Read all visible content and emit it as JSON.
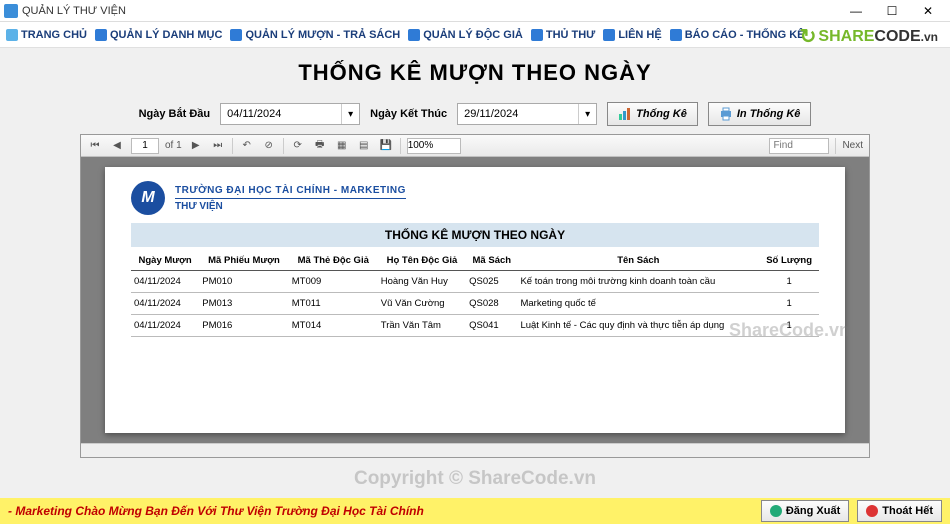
{
  "window": {
    "title": "QUẢN LÝ THƯ VIỆN"
  },
  "menu": {
    "items": [
      {
        "label": "TRANG CHỦ"
      },
      {
        "label": "QUẢN LÝ DANH MỤC"
      },
      {
        "label": "QUẢN LÝ MƯỢN - TRẢ SÁCH"
      },
      {
        "label": "QUẢN LÝ ĐỘC GIẢ"
      },
      {
        "label": "THỦ THƯ"
      },
      {
        "label": "LIÊN HỆ"
      },
      {
        "label": "BÁO CÁO - THỐNG KÊ"
      }
    ]
  },
  "brand": {
    "icon_text": "↻",
    "part1": "SHARE",
    "part2": "CODE",
    "suffix": ".vn"
  },
  "page": {
    "heading": "THỐNG KÊ MƯỢN THEO NGÀY"
  },
  "filter": {
    "start_label": "Ngày Bắt Đầu",
    "start_value": "04/11/2024",
    "end_label": "Ngày Kết Thúc",
    "end_value": "29/11/2024",
    "btn_stats": "Thống Kê",
    "btn_print": "In Thống Kê"
  },
  "viewer": {
    "page_current": "1",
    "page_of": "of 1",
    "zoom": "100%",
    "find_placeholder": "Find",
    "next_label": "Next"
  },
  "report": {
    "org_line1": "TRƯỜNG ĐẠI HỌC TÀI CHÍNH - MARKETING",
    "org_line2": "THƯ VIỆN",
    "logo_letter": "M",
    "title": "THỐNG KÊ MƯỢN THEO NGÀY",
    "columns": [
      "Ngày Mượn",
      "Mã Phiếu Mượn",
      "Mã Thẻ Độc Giả",
      "Họ Tên Độc Giả",
      "Mã Sách",
      "Tên Sách",
      "Số Lượng"
    ],
    "rows": [
      {
        "c0": "04/11/2024",
        "c1": "PM010",
        "c2": "MT009",
        "c3": "Hoàng Văn Huy",
        "c4": "QS025",
        "c5": "Kế toán trong môi trường kinh doanh toàn cầu",
        "c6": "1"
      },
      {
        "c0": "04/11/2024",
        "c1": "PM013",
        "c2": "MT011",
        "c3": "Vũ Văn Cường",
        "c4": "QS028",
        "c5": "Marketing quốc tế",
        "c6": "1"
      },
      {
        "c0": "04/11/2024",
        "c1": "PM016",
        "c2": "MT014",
        "c3": "Trần Văn Tâm",
        "c4": "QS041",
        "c5": "Luật Kinh tế - Các quy định và thực tiễn áp dụng",
        "c6": "1"
      }
    ]
  },
  "watermarks": {
    "side": "ShareCode.vn",
    "bottom": "Copyright © ShareCode.vn"
  },
  "footer": {
    "marquee": "- Marketing Chào Mừng Bạn Đến Với Thư Viện Trường Đại Học Tài Chính",
    "logout": "Đăng Xuất",
    "exit": "Thoát Hết"
  }
}
